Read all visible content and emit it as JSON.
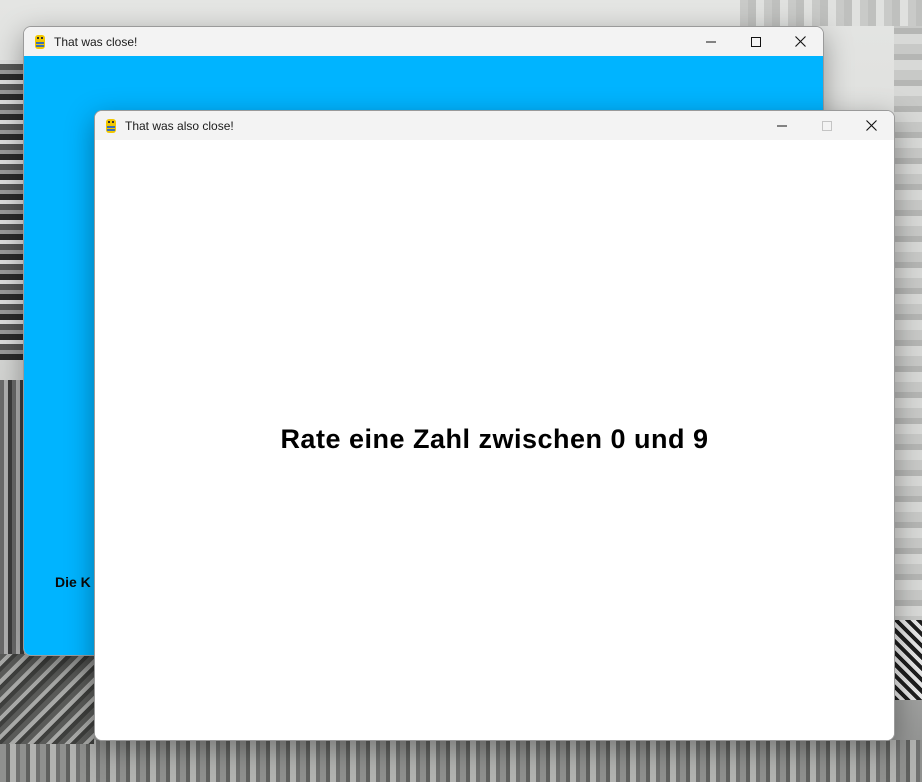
{
  "desktop": {
    "wallpaper_icon": "pixel-art-landscape"
  },
  "window_back": {
    "title": "That was close!",
    "app_icon": "pygame-snake-icon",
    "background_color": "#00b4ff",
    "visible_text": "Die K",
    "controls": [
      "minimize",
      "maximize",
      "close"
    ]
  },
  "window_front": {
    "title": "That was also close!",
    "app_icon": "pygame-snake-icon",
    "background_color": "#ffffff",
    "message": "Rate eine Zahl zwischen 0 und 9",
    "controls": [
      "minimize",
      "maximize-disabled",
      "close"
    ]
  }
}
